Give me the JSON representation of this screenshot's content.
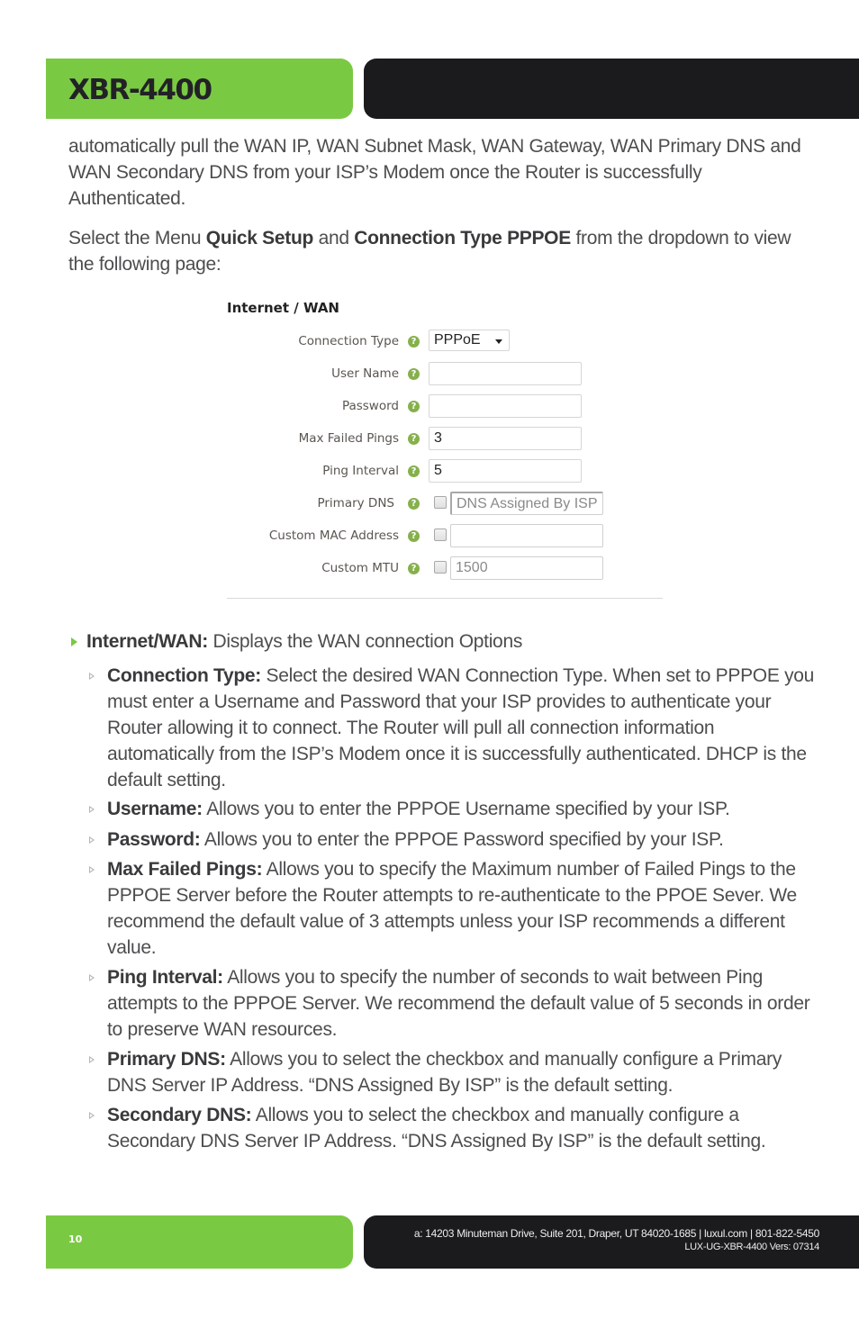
{
  "header": {
    "title": "XBR-4400",
    "accent_color": "#7ac943",
    "dark_color": "#1b1a1d"
  },
  "intro": {
    "paragraph1": "automatically pull the WAN IP, WAN Subnet Mask, WAN Gateway, WAN Primary DNS and WAN Secondary DNS from your ISP’s Modem once the Router is successfully Authenticated.",
    "paragraph2": {
      "part1": "Select the Menu ",
      "bold1": "Quick Setup",
      "part2": " and ",
      "bold2": "Connection Type PPPOE",
      "part3": " from the dropdown to view the following page:"
    }
  },
  "form": {
    "title": "Internet / WAN",
    "help_icon_glyph": "?",
    "fields": [
      {
        "label": "Connection Type",
        "type": "select",
        "value": "PPPoE"
      },
      {
        "label": "User Name",
        "type": "text",
        "value": ""
      },
      {
        "label": "Password",
        "type": "password",
        "value": ""
      },
      {
        "label": "Max Failed Pings",
        "type": "text",
        "value": "3"
      },
      {
        "label": "Ping Interval",
        "type": "text",
        "value": "5"
      },
      {
        "label": "Primary DNS",
        "type": "checkbox-text",
        "checked": false,
        "value": "DNS Assigned By ISP"
      },
      {
        "label": "Custom MAC Address",
        "type": "checkbox-text",
        "checked": false,
        "value": ""
      },
      {
        "label": "Custom MTU",
        "type": "checkbox-text",
        "checked": false,
        "value": "1500"
      }
    ]
  },
  "bullets": {
    "main": {
      "term": "Internet/WAN:",
      "text": " Displays the WAN connection Options"
    },
    "items": [
      {
        "term": "Connection Type:",
        "text": " Select the desired WAN Connection Type. When set to PPPOE you must enter a Username and Password that your ISP provides to authenticate your Router allowing it to connect. The Router will pull all connection information automatically from the ISP’s Modem once it is successfully authenticated. DHCP is the default setting."
      },
      {
        "term": "Username:",
        "text": " Allows you to enter the PPPOE Username specified by your ISP."
      },
      {
        "term": "Password:",
        "text": " Allows you to enter the PPPOE Password specified by your ISP."
      },
      {
        "term": "Max Failed Pings:",
        "text": " Allows you to specify the Maximum number of Failed Pings to the PPPOE Server before the Router attempts to re-authenticate to the PPOE Sever. We recommend the default value of 3 attempts unless your ISP recommends a different value."
      },
      {
        "term": "Ping Interval:",
        "text": " Allows you to specify the number of seconds to wait between Ping attempts to the PPPOE Server. We recommend the default value of 5 seconds in order to preserve WAN resources."
      },
      {
        "term": "Primary DNS:",
        "text": " Allows you to select the checkbox and manually configure a Primary DNS Server IP Address. “DNS Assigned By ISP” is the default setting."
      },
      {
        "term": "Secondary DNS:",
        "text": " Allows you to select the checkbox and manually configure a Secondary DNS Server IP Address. “DNS Assigned By ISP” is the default setting."
      }
    ]
  },
  "footer": {
    "page_number": "10",
    "address": "a: 14203 Minuteman Drive, Suite 201, Draper, UT 84020-1685 | luxul.com | 801-822-5450",
    "version": "LUX-UG-XBR-4400  Vers: 07314"
  }
}
